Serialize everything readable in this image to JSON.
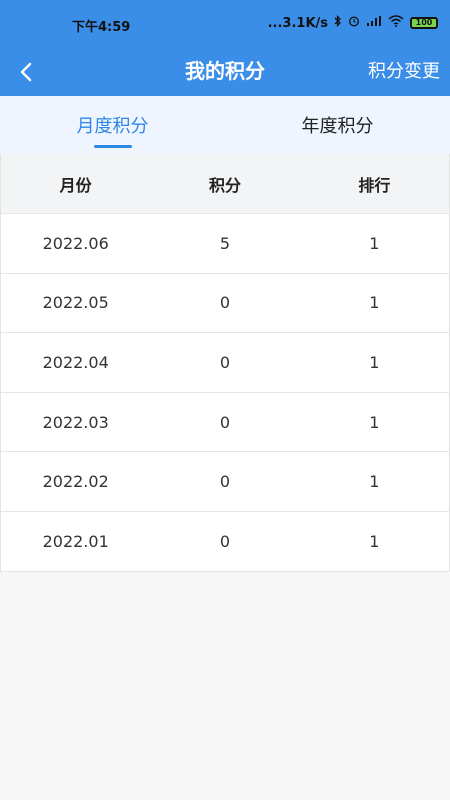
{
  "status": {
    "time": "下午4:59",
    "net_speed": "...3.1K/s",
    "battery": "100"
  },
  "nav": {
    "title": "我的积分",
    "action": "积分变更"
  },
  "tabs": [
    {
      "label": "月度积分",
      "active": true
    },
    {
      "label": "年度积分",
      "active": false
    }
  ],
  "table": {
    "headers": [
      "月份",
      "积分",
      "排行"
    ],
    "rows": [
      [
        "2022.06",
        "5",
        "1"
      ],
      [
        "2022.05",
        "0",
        "1"
      ],
      [
        "2022.04",
        "0",
        "1"
      ],
      [
        "2022.03",
        "0",
        "1"
      ],
      [
        "2022.02",
        "0",
        "1"
      ],
      [
        "2022.01",
        "0",
        "1"
      ]
    ]
  },
  "colors": {
    "primary": "#3b8ee8",
    "tab_active": "#2f86e5",
    "tab_bg": "#eef5fe",
    "page_bg": "#f6f6f6"
  },
  "icons": {
    "back": "chevron-left-icon",
    "bluetooth": "bluetooth-icon",
    "alarm": "alarm-icon",
    "signal": "signal-icon",
    "wifi": "wifi-icon",
    "battery": "battery-icon"
  }
}
